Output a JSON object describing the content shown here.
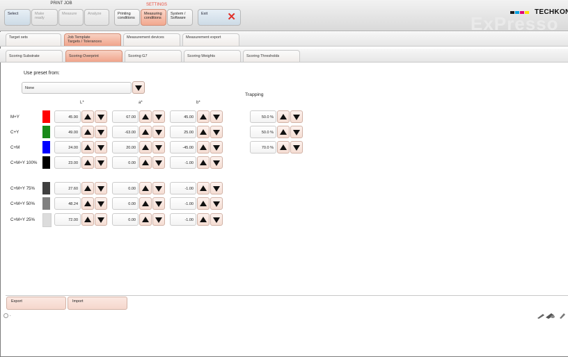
{
  "header": {
    "print_job_label": "PRINT JOB",
    "settings_label": "SETTINGS",
    "buttons": [
      {
        "id": "select",
        "line1": "Select",
        "line2": ""
      },
      {
        "id": "make-ready",
        "line1": "Make ready",
        "line2": ""
      },
      {
        "id": "measure",
        "line1": "Measure",
        "line2": ""
      },
      {
        "id": "analyze",
        "line1": "Analyze",
        "line2": ""
      },
      {
        "id": "printing-conditions",
        "line1": "Printing",
        "line2": "conditions"
      },
      {
        "id": "measuring-conditions",
        "line1": "Measuring",
        "line2": "conditions"
      },
      {
        "id": "system-software",
        "line1": "System /",
        "line2": "Software"
      },
      {
        "id": "exit",
        "line1": "Exit",
        "line2": ""
      }
    ],
    "logo_brand": "TECHKON",
    "logo_product": "ExPresso"
  },
  "tabs_row1": [
    {
      "line1": "Target sets",
      "line2": ""
    },
    {
      "line1": "Job Template",
      "line2": "Targets / Tolerances"
    },
    {
      "line1": "Measurement devices",
      "line2": ""
    },
    {
      "line1": "Measurement export",
      "line2": ""
    }
  ],
  "tabs_row2": [
    {
      "label": "Scoring Substrate"
    },
    {
      "label": "Scoring Overprint"
    },
    {
      "label": "Scoring G7"
    },
    {
      "label": "Scoring Weights"
    },
    {
      "label": "Scoring Thresholds"
    }
  ],
  "preset": {
    "title": "Use preset from:",
    "value": "None"
  },
  "columns": {
    "l": "L*",
    "a": "a*",
    "b": "b*",
    "trapping": "Trapping"
  },
  "rows": [
    {
      "label": "M+Y",
      "color": "#ff0000",
      "l": "45.90",
      "a": "67.00",
      "b": "45.00",
      "trap": "50.0 %"
    },
    {
      "label": "C+Y",
      "color": "#1a8a1a",
      "l": "49.00",
      "a": "-63.00",
      "b": "25.00",
      "trap": "50.0 %"
    },
    {
      "label": "C+M",
      "color": "#0000ff",
      "l": "24.00",
      "a": "20.00",
      "b": "-45.00",
      "trap": "70.0 %"
    },
    {
      "label": "C+M+Y 100%",
      "color": "#000000",
      "l": "23.00",
      "a": "0.00",
      "b": "-1.00"
    },
    {
      "label": "C+M+Y 75%",
      "color": "#404040",
      "l": "27.60",
      "a": "0.00",
      "b": "-1.00"
    },
    {
      "label": "C+M+Y 50%",
      "color": "#808080",
      "l": "48.24",
      "a": "0.00",
      "b": "-1.00"
    },
    {
      "label": "C+M+Y 25%",
      "color": "#dcdcdc",
      "l": "72.00",
      "a": "0.00",
      "b": "-1.00"
    }
  ],
  "footer": {
    "export_label": "Export",
    "import_label": "Import",
    "status_text": "-"
  }
}
